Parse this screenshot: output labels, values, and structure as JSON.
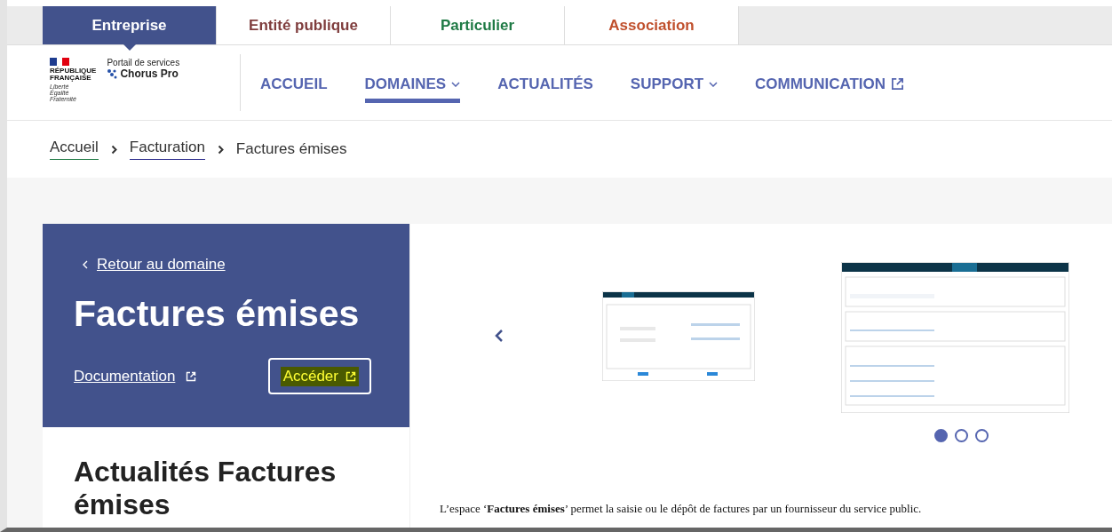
{
  "audience_tabs": [
    {
      "label": "Entreprise",
      "selected": true,
      "color": "#42528c"
    },
    {
      "label": "Entité publique",
      "selected": false,
      "color": "#7f3d3d"
    },
    {
      "label": "Particulier",
      "selected": false,
      "color": "#1f7a45"
    },
    {
      "label": "Association",
      "selected": false,
      "color": "#c0502d"
    }
  ],
  "logo": {
    "republic": "RÉPUBLIQUE\nFRANÇAISE",
    "motto": "Liberté\nÉgalité\nFraternité",
    "portal": "Portail de services",
    "product": "Chorus Pro"
  },
  "nav": [
    {
      "label": "ACCUEIL",
      "selected": false,
      "kind": "plain"
    },
    {
      "label": "DOMAINES",
      "selected": true,
      "kind": "dropdown"
    },
    {
      "label": "ACTUALITÉS",
      "selected": false,
      "kind": "plain"
    },
    {
      "label": "SUPPORT",
      "selected": false,
      "kind": "dropdown"
    },
    {
      "label": "COMMUNICATION",
      "selected": false,
      "kind": "external"
    }
  ],
  "breadcrumb": [
    {
      "label": "Accueil",
      "kind": "link",
      "color": "#1f7a45"
    },
    {
      "label": "Facturation",
      "kind": "link",
      "color": "#2b2b8c"
    },
    {
      "label": "Factures émises",
      "kind": "current"
    }
  ],
  "hero": {
    "back": "Retour au domaine",
    "title": "Factures émises",
    "doc_link": "Documentation",
    "access_button": "Accéder"
  },
  "news_title": "Actualités Factures émises",
  "carousel": {
    "dots": [
      {
        "selected": true
      },
      {
        "selected": false
      },
      {
        "selected": false
      }
    ]
  },
  "description": "L’espace ‘**Factures émises**’ permet la saisie ou le dépôt de factures par un fournisseur du service public."
}
